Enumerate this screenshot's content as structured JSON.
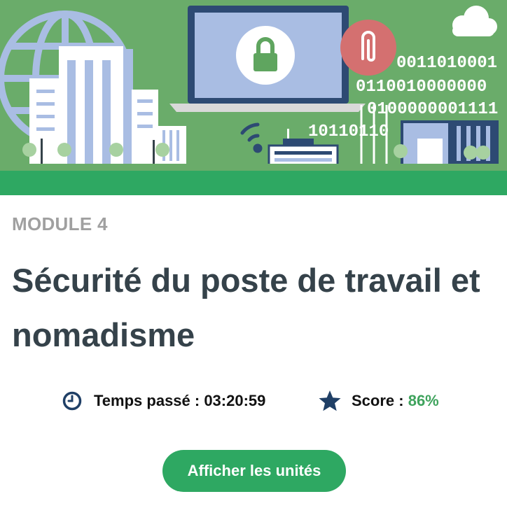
{
  "banner": {
    "binary_lines": [
      "0011010001",
      "0110010000000",
      "0100000001111",
      "10110110"
    ],
    "colors": {
      "background": "#6aac6a",
      "stripe": "#2ea862",
      "lock_badge": "#ffffff",
      "clip_badge": "#d47070"
    }
  },
  "module": {
    "label": "MODULE 4",
    "title": "Sécurité du poste de travail et nomadisme"
  },
  "stats": {
    "time_label": "Temps passé : 03:20:59",
    "score_label": "Score : ",
    "score_value": "86%",
    "icons": [
      "clock-icon",
      "star-icon"
    ]
  },
  "actions": {
    "show_units_label": "Afficher les unités"
  },
  "colors": {
    "title": "#35424a",
    "muted": "#a0a0a0",
    "accent": "#2ea862",
    "icon": "#1f3f66"
  }
}
